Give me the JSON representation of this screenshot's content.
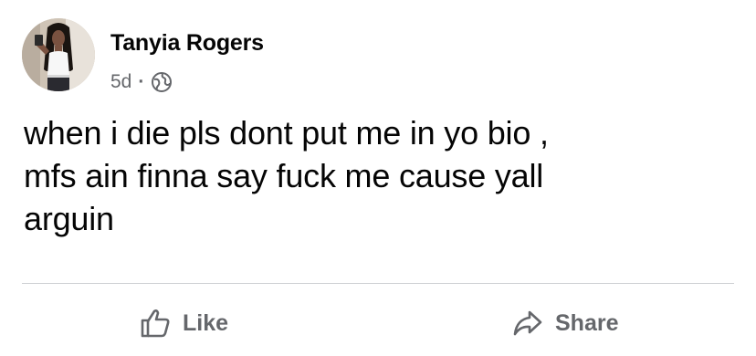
{
  "post": {
    "author_name": "Tanyia Rogers",
    "timestamp": "5d",
    "separator": "·",
    "privacy_icon": "globe-icon",
    "text": "when i die pls dont put me in yo bio ,\nmfs ain finna say fuck me cause yall\narguin"
  },
  "actions": {
    "like_label": "Like",
    "like_icon": "thumbs-up-icon",
    "share_label": "Share",
    "share_icon": "share-arrow-icon"
  },
  "colors": {
    "text_primary": "#050505",
    "text_secondary": "#65676b",
    "divider": "#ced0d4",
    "background": "#ffffff"
  }
}
